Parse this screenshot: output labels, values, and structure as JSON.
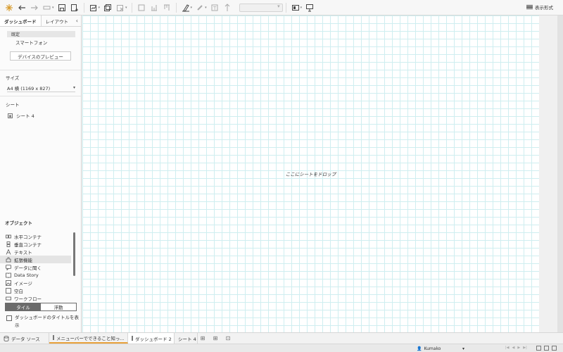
{
  "toolbar": {
    "show_me_label": "表示形式"
  },
  "left_panel": {
    "tabs": {
      "dashboard": "ダッシュボード",
      "layout": "レイアウト",
      "collapse": "‹"
    },
    "device": {
      "default": "既定",
      "phone": "スマートフォン",
      "preview_button": "デバイスのプレビュー"
    },
    "size": {
      "title": "サイズ",
      "value": "A4 横 (1169 x 827)"
    },
    "sheets": {
      "title": "シート",
      "items": [
        "シート 4"
      ]
    },
    "objects": {
      "title": "オブジェクト",
      "items": [
        {
          "label": "水平コンテナ",
          "icon": "horizontal-container-icon"
        },
        {
          "label": "垂直コンテナ",
          "icon": "vertical-container-icon"
        },
        {
          "label": "テキスト",
          "icon": "text-icon"
        },
        {
          "label": "拡張機能",
          "icon": "extension-icon",
          "selected": true
        },
        {
          "label": "データに聞く",
          "icon": "ask-data-icon"
        },
        {
          "label": "Data Story",
          "icon": "data-story-icon"
        },
        {
          "label": "イメージ",
          "icon": "image-icon"
        },
        {
          "label": "空白",
          "icon": "blank-icon"
        },
        {
          "label": "ワークフロー",
          "icon": "workflow-icon"
        }
      ],
      "tile": "タイル",
      "float": "浮動"
    },
    "show_title_checkbox": "ダッシュボードのタイトルを表示"
  },
  "canvas": {
    "drop_text": "ここにシートをドロップ"
  },
  "bottom_tabs": {
    "data_source": "データ ソース",
    "tab1": "メニューバーでできること知っ...",
    "tab2": "ダッシュボード 2",
    "tab3": "シート 4"
  },
  "status": {
    "user": "Kumako"
  }
}
